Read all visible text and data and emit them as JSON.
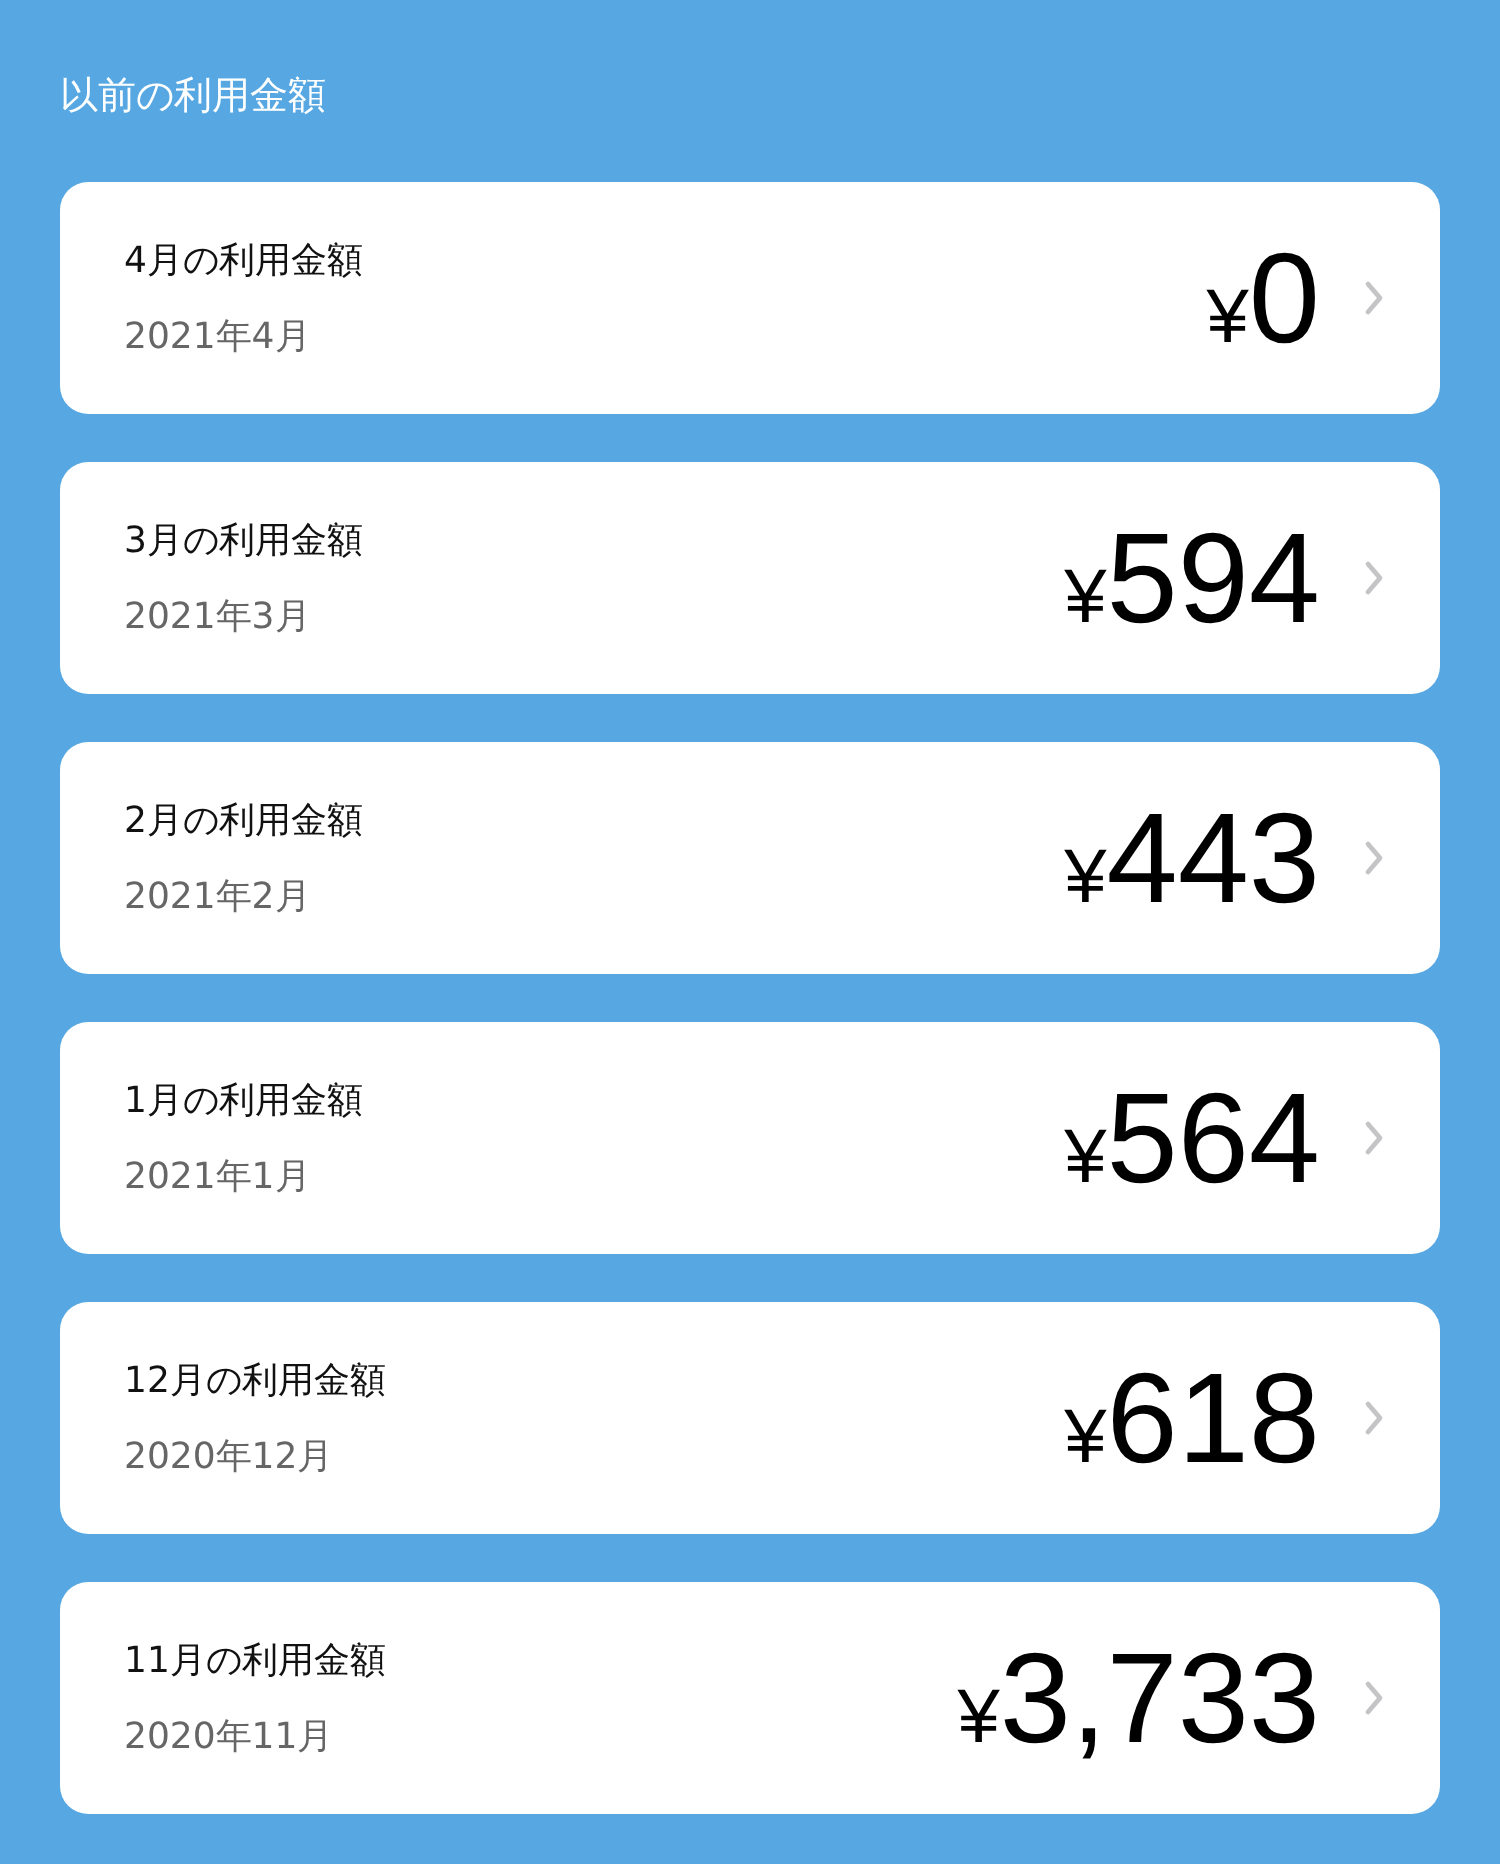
{
  "section_title": "以前の利用金額",
  "months": [
    {
      "title": "4月の利用金額",
      "period": "2021年4月",
      "amount": "¥0"
    },
    {
      "title": "3月の利用金額",
      "period": "2021年3月",
      "amount": "¥594"
    },
    {
      "title": "2月の利用金額",
      "period": "2021年2月",
      "amount": "¥443"
    },
    {
      "title": "1月の利用金額",
      "period": "2021年1月",
      "amount": "¥564"
    },
    {
      "title": "12月の利用金額",
      "period": "2020年12月",
      "amount": "¥618"
    },
    {
      "title": "11月の利用金額",
      "period": "2020年11月",
      "amount": "¥3,733"
    }
  ]
}
